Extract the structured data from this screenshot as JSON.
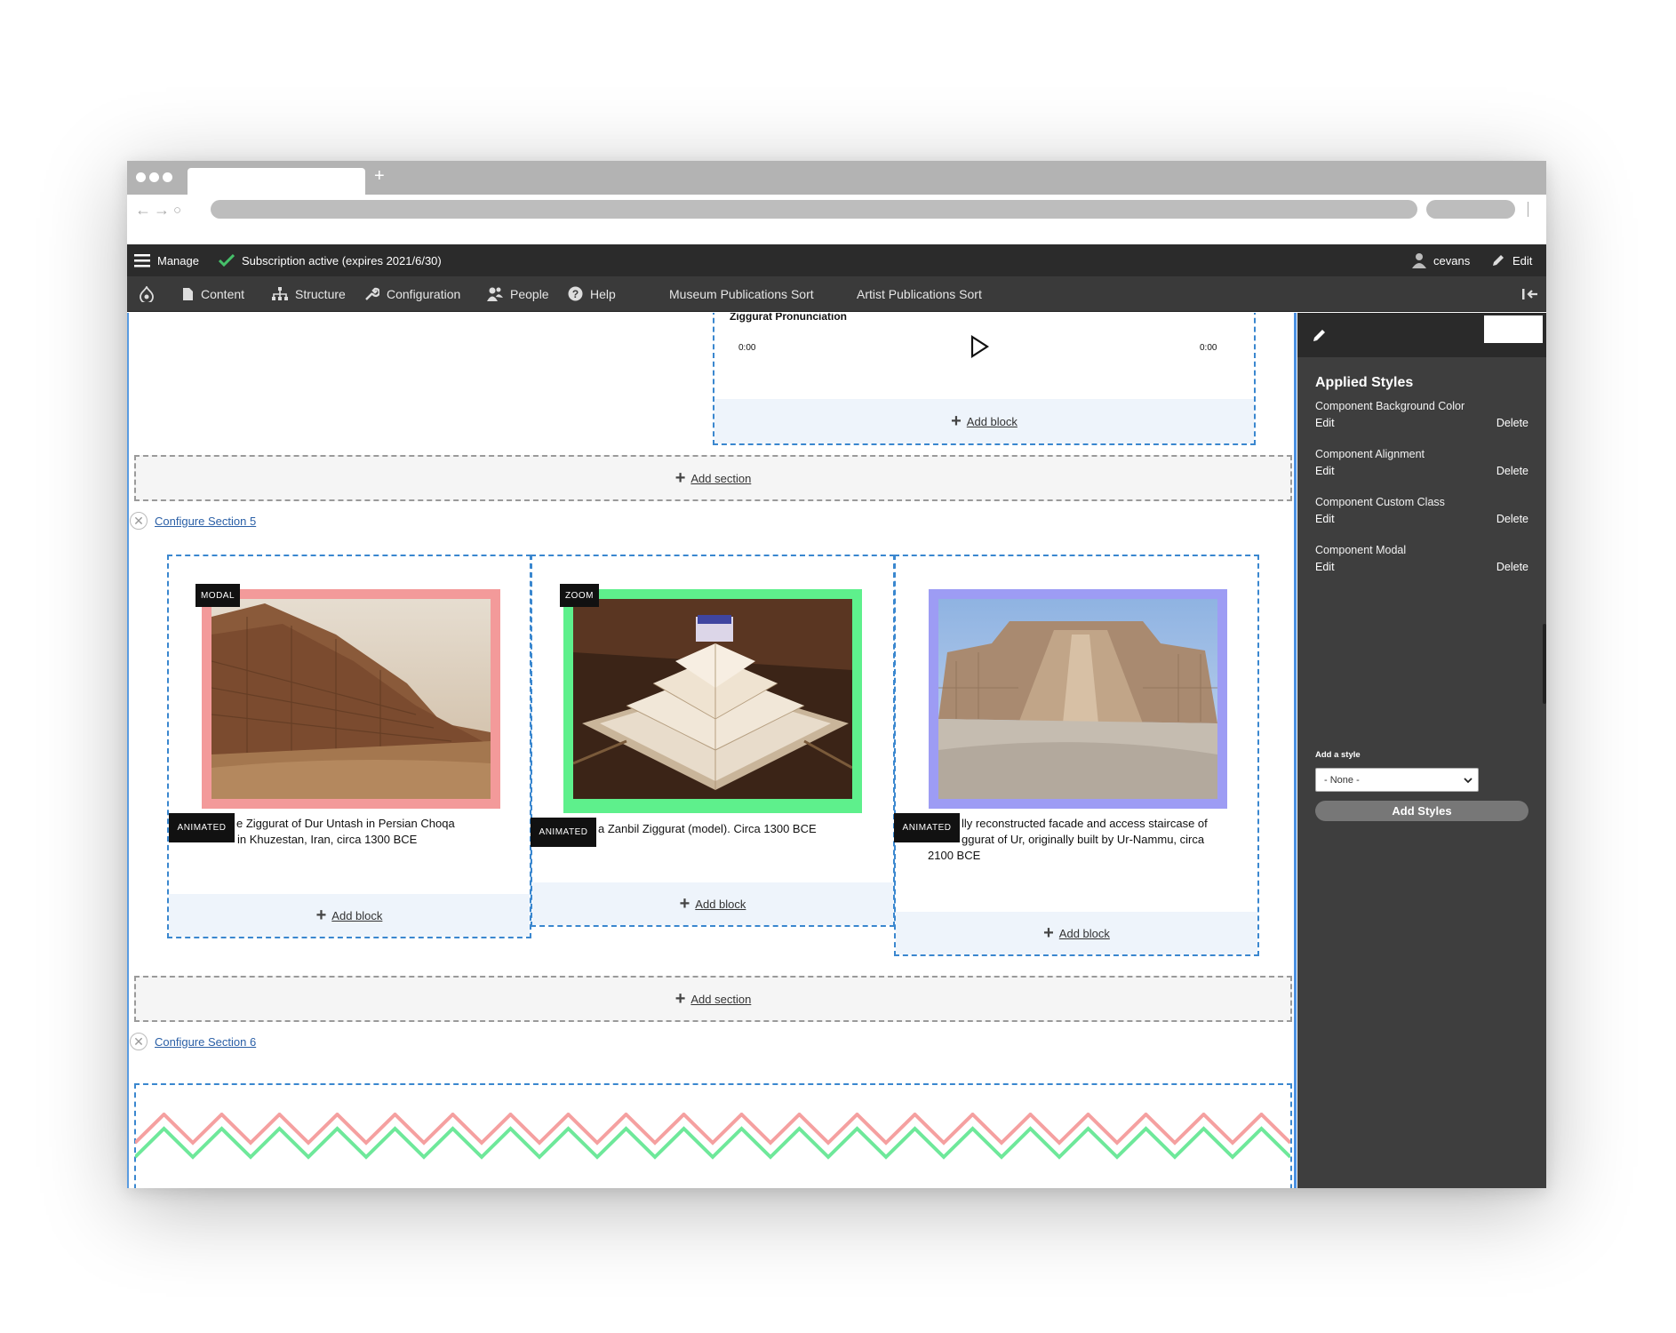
{
  "browser": {
    "new_tab_glyph": "+",
    "back_glyph": "←",
    "forward_glyph": "→",
    "reload_glyph": "○"
  },
  "toolbar": {
    "manage_label": "Manage",
    "subscription_label": "Subscription active (expires 2021/6/30)",
    "user_label": "cevans",
    "edit_label": "Edit"
  },
  "menu": {
    "items": [
      {
        "label": "Content",
        "icon": "file-icon"
      },
      {
        "label": "Structure",
        "icon": "structure-icon"
      },
      {
        "label": "Configuration",
        "icon": "wrench-icon"
      },
      {
        "label": "People",
        "icon": "people-icon"
      },
      {
        "label": "Help",
        "icon": "help-icon"
      },
      {
        "label": "Museum Publications Sort"
      },
      {
        "label": "Artist Publications Sort"
      }
    ]
  },
  "audio": {
    "title": "Ziggurat Pronunciation",
    "current_time": "0:00",
    "duration": "0:00"
  },
  "layout": {
    "add_block": "Add block",
    "add_section": "Add section",
    "configure_section_5": "Configure Section 5",
    "configure_section_6": "Configure Section 6"
  },
  "cards": [
    {
      "tag_top": "MODAL",
      "tag_bottom": "ANIMATED",
      "frame_color": "#f39a9a",
      "caption_line1": "e Ziggurat of Dur Untash in Persian Choqa",
      "caption_line2": "in Khuzestan, Iran, circa 1300 BCE"
    },
    {
      "tag_top": "ZOOM",
      "tag_bottom": "ANIMATED",
      "frame_color": "#5ef08c",
      "caption_line1": "a Zanbil Ziggurat (model). Circa 1300 BCE"
    },
    {
      "tag_bottom": "ANIMATED",
      "frame_color": "#9d9cf4",
      "caption_line1": "lly reconstructed facade and access staircase of",
      "caption_line2": "ggurat of Ur, originally built by Ur-Nammu, circa",
      "caption_line3": "2100 BCE"
    }
  ],
  "sidebar": {
    "title": "Applied Styles",
    "styles": [
      {
        "name": "Component Background Color",
        "edit": "Edit",
        "delete": "Delete"
      },
      {
        "name": "Component Alignment",
        "edit": "Edit",
        "delete": "Delete"
      },
      {
        "name": "Component Custom Class",
        "edit": "Edit",
        "delete": "Delete"
      },
      {
        "name": "Component Modal",
        "edit": "Edit",
        "delete": "Delete"
      }
    ],
    "add_style_label": "Add a style",
    "select_value": "- None -",
    "button_label": "Add Styles"
  },
  "colors": {
    "zigzag_top": "#f5a0a0",
    "zigzag_bottom": "#6ee89a",
    "region_border": "#3a87cf"
  }
}
